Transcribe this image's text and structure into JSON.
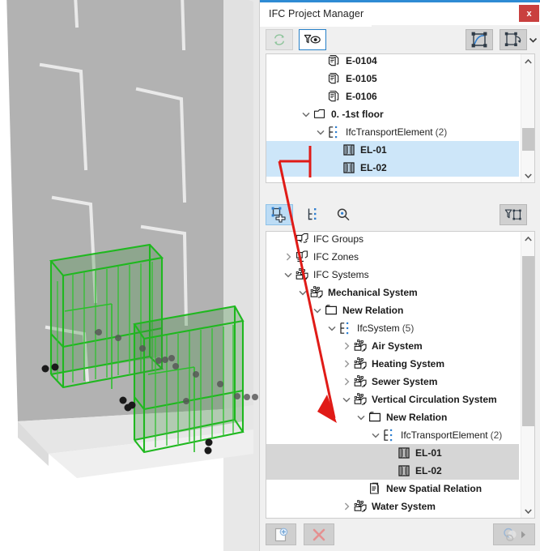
{
  "window": {
    "title": "IFC Project Manager",
    "close_label": "x",
    "close_icon": "close-icon",
    "accent_color": "#2e8bd4",
    "close_color": "#c9403f"
  },
  "toolbar_top": {
    "buttons": [
      {
        "name": "refresh-button",
        "icon": "refresh-circular-arrows-icon",
        "state": "disabled",
        "tooltip": "Refresh"
      },
      {
        "name": "filter-visibility-button",
        "icon": "funnel-eye-icon",
        "state": "selected",
        "tooltip": "Filter / Show"
      },
      {
        "name": "select-elements-button",
        "icon": "marquee-selection-icon",
        "state": "normal",
        "tooltip": "Select Elements"
      },
      {
        "name": "show-in-tree-button",
        "icon": "frame-arrow-icon",
        "state": "normal",
        "tooltip": "Show in Tree"
      }
    ],
    "collapse_icon": "chevron-down-icon"
  },
  "toolbar_mid": {
    "buttons": [
      {
        "name": "new-relation-button",
        "icon": "node-plus-icon",
        "state": "selected",
        "tooltip": "New Relation"
      },
      {
        "name": "tree-list-button",
        "icon": "tree-list-icon",
        "state": "flat",
        "tooltip": "Tree List"
      },
      {
        "name": "search-button",
        "icon": "search-icon",
        "state": "flat",
        "tooltip": "Search"
      },
      {
        "name": "filter-tree-button",
        "icon": "funnel-frame-icon",
        "state": "normal",
        "tooltip": "Filter Tree"
      }
    ]
  },
  "toolbar_bottom": {
    "buttons": [
      {
        "name": "new-item-button",
        "icon": "page-plus-icon",
        "state": "disabled",
        "tooltip": "New"
      },
      {
        "name": "delete-item-button",
        "icon": "red-x-icon",
        "state": "disabled",
        "tooltip": "Delete"
      },
      {
        "name": "settings-button",
        "icon": "overlapping-circles-icon",
        "state": "disabled",
        "tooltip": "Options"
      }
    ],
    "settings_arrow_icon": "triangle-right-icon"
  },
  "tree_top": {
    "name": "project-structure-tree",
    "scroll_thumb": {
      "top_pct": 60,
      "height_pct": 22
    },
    "rows": [
      {
        "indent": 3,
        "twisty": "none",
        "icon": "document-element-icon",
        "label": "E-0104",
        "bold": true,
        "selected": false,
        "count": ""
      },
      {
        "indent": 3,
        "twisty": "none",
        "icon": "document-element-icon",
        "label": "E-0105",
        "bold": true,
        "selected": false,
        "count": ""
      },
      {
        "indent": 3,
        "twisty": "none",
        "icon": "document-element-icon",
        "label": "E-0106",
        "bold": true,
        "selected": false,
        "count": ""
      },
      {
        "indent": 2,
        "twisty": "open",
        "icon": "storey-icon",
        "label": "0.  -1st floor",
        "bold": true,
        "selected": false,
        "count": ""
      },
      {
        "indent": 3,
        "twisty": "open",
        "icon": "ifc-class-icon",
        "label": "IfcTransportElement",
        "bold": false,
        "selected": false,
        "count": "(2)"
      },
      {
        "indent": 4,
        "twisty": "none",
        "icon": "elevator-icon",
        "label": "EL-01",
        "bold": true,
        "selected": "blue",
        "count": ""
      },
      {
        "indent": 4,
        "twisty": "none",
        "icon": "elevator-icon",
        "label": "EL-02",
        "bold": true,
        "selected": "blue",
        "count": ""
      }
    ]
  },
  "tree_bottom": {
    "name": "ifc-classification-tree",
    "scroll_thumb": {
      "top_pct": 4,
      "height_pct": 66
    },
    "rows": [
      {
        "indent": 1,
        "twisty": "none",
        "icon": "ifc-groups-icon",
        "label": "IFC Groups",
        "bold": false,
        "selected": false,
        "count": ""
      },
      {
        "indent": 1,
        "twisty": "closed",
        "icon": "ifc-zones-icon",
        "label": "IFC Zones",
        "bold": false,
        "selected": false,
        "count": ""
      },
      {
        "indent": 1,
        "twisty": "open",
        "icon": "ifc-systems-icon",
        "label": "IFC Systems",
        "bold": false,
        "selected": false,
        "count": ""
      },
      {
        "indent": 2,
        "twisty": "open",
        "icon": "ifc-systems-icon",
        "label": "Mechanical System",
        "bold": true,
        "selected": false,
        "count": ""
      },
      {
        "indent": 3,
        "twisty": "open",
        "icon": "folder-icon",
        "label": "New Relation",
        "bold": true,
        "selected": false,
        "count": ""
      },
      {
        "indent": 4,
        "twisty": "open",
        "icon": "ifc-class-icon",
        "label": "IfcSystem",
        "bold": false,
        "selected": false,
        "count": "(5)"
      },
      {
        "indent": 5,
        "twisty": "closed",
        "icon": "ifc-systems-icon",
        "label": "Air System",
        "bold": true,
        "selected": false,
        "count": ""
      },
      {
        "indent": 5,
        "twisty": "closed",
        "icon": "ifc-systems-icon",
        "label": "Heating System",
        "bold": true,
        "selected": false,
        "count": ""
      },
      {
        "indent": 5,
        "twisty": "closed",
        "icon": "ifc-systems-icon",
        "label": "Sewer System",
        "bold": true,
        "selected": false,
        "count": ""
      },
      {
        "indent": 5,
        "twisty": "open",
        "icon": "ifc-systems-icon",
        "label": "Vertical Circulation System",
        "bold": true,
        "selected": false,
        "count": ""
      },
      {
        "indent": 6,
        "twisty": "open",
        "icon": "folder-icon",
        "label": "New Relation",
        "bold": true,
        "selected": false,
        "count": ""
      },
      {
        "indent": 7,
        "twisty": "open",
        "icon": "ifc-class-icon",
        "label": "IfcTransportElement",
        "bold": false,
        "selected": false,
        "count": "(2)"
      },
      {
        "indent": 8,
        "twisty": "none",
        "icon": "elevator-icon",
        "label": "EL-01",
        "bold": true,
        "selected": "grey",
        "count": ""
      },
      {
        "indent": 8,
        "twisty": "none",
        "icon": "elevator-icon",
        "label": "EL-02",
        "bold": true,
        "selected": "grey",
        "count": ""
      },
      {
        "indent": 6,
        "twisty": "none",
        "icon": "spatial-relation-icon",
        "label": "New Spatial Relation",
        "bold": true,
        "selected": false,
        "count": ""
      },
      {
        "indent": 5,
        "twisty": "closed",
        "icon": "ifc-systems-icon",
        "label": "Water System",
        "bold": true,
        "selected": false,
        "count": ""
      }
    ]
  },
  "viewport": {
    "name": "3d-model-viewport",
    "description": "3D axonometric view of a grey building tower with two green-highlighted elevator shaft volumes at its base",
    "highlight_color": "#1eb21e",
    "building_color": "#b2b2b2"
  },
  "annotation": {
    "name": "red-callout-arrow",
    "color": "#e01b17",
    "description": "Red arrow pointing from the selected EL-01/EL-02 rows in the top tree down to the New Relation row in the bottom tree"
  }
}
